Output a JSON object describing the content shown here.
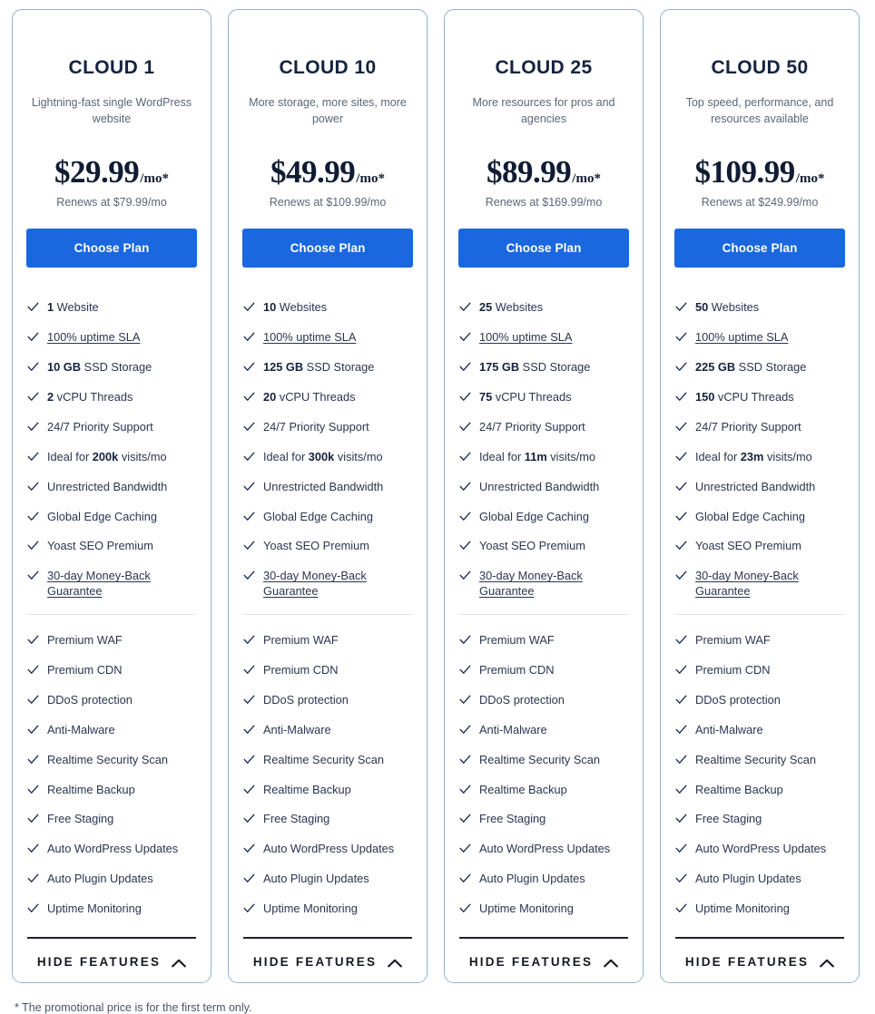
{
  "page": {
    "footnote": "* The promotional price is for the first term only.",
    "accent_color": "#1a67e0",
    "card_border_color": "#8fb4cf",
    "text_color": "#2b3550",
    "heading_color": "#15233f"
  },
  "labels": {
    "cta": "Choose Plan",
    "hide_features": "HIDE FEATURES",
    "check_icon": "check-icon",
    "chevron_up_icon": "chevron-up-icon"
  },
  "plans": [
    {
      "name": "CLOUD 1",
      "tagline": "Lightning-fast single WordPress website",
      "price": "$29.99",
      "price_suffix": "/mo*",
      "renews": "Renews at $79.99/mo",
      "cta": "Choose Plan",
      "features_primary": [
        {
          "bold": "1",
          "text": " Website",
          "underline": false
        },
        {
          "bold": "",
          "text": "100% uptime SLA",
          "underline": true
        },
        {
          "bold": "10 GB",
          "text": " SSD Storage",
          "underline": false
        },
        {
          "bold": "2",
          "text": " vCPU Threads",
          "underline": false
        },
        {
          "bold": "",
          "text": "24/7 Priority Support",
          "underline": false
        },
        {
          "bold": "",
          "text": "Ideal for ",
          "bold_mid": "200k",
          "text_after": " visits/mo",
          "underline": false
        },
        {
          "bold": "",
          "text": "Unrestricted Bandwidth",
          "underline": false
        },
        {
          "bold": "",
          "text": "Global Edge Caching",
          "underline": false
        },
        {
          "bold": "",
          "text": "Yoast SEO Premium",
          "underline": false
        },
        {
          "bold": "",
          "text": "30-day Money-Back Guarantee",
          "underline": true
        }
      ],
      "features_secondary": [
        "Premium WAF",
        "Premium CDN",
        "DDoS protection",
        "Anti-Malware",
        "Realtime Security Scan",
        "Realtime Backup",
        "Free Staging",
        "Auto WordPress Updates",
        "Auto Plugin Updates",
        "Uptime Monitoring"
      ],
      "hide_features": "HIDE FEATURES"
    },
    {
      "name": "CLOUD 10",
      "tagline": "More storage, more sites, more power",
      "price": "$49.99",
      "price_suffix": "/mo*",
      "renews": "Renews at $109.99/mo",
      "cta": "Choose Plan",
      "features_primary": [
        {
          "bold": "10",
          "text": " Websites",
          "underline": false
        },
        {
          "bold": "",
          "text": "100% uptime SLA",
          "underline": true
        },
        {
          "bold": "125 GB",
          "text": " SSD Storage",
          "underline": false
        },
        {
          "bold": "20",
          "text": " vCPU Threads",
          "underline": false
        },
        {
          "bold": "",
          "text": "24/7 Priority Support",
          "underline": false
        },
        {
          "bold": "",
          "text": "Ideal for ",
          "bold_mid": "300k",
          "text_after": " visits/mo",
          "underline": false
        },
        {
          "bold": "",
          "text": "Unrestricted Bandwidth",
          "underline": false
        },
        {
          "bold": "",
          "text": "Global Edge Caching",
          "underline": false
        },
        {
          "bold": "",
          "text": "Yoast SEO Premium",
          "underline": false
        },
        {
          "bold": "",
          "text": "30-day Money-Back Guarantee",
          "underline": true
        }
      ],
      "features_secondary": [
        "Premium WAF",
        "Premium CDN",
        "DDoS protection",
        "Anti-Malware",
        "Realtime Security Scan",
        "Realtime Backup",
        "Free Staging",
        "Auto WordPress Updates",
        "Auto Plugin Updates",
        "Uptime Monitoring"
      ],
      "hide_features": "HIDE FEATURES"
    },
    {
      "name": "CLOUD 25",
      "tagline": "More resources for pros and agencies",
      "price": "$89.99",
      "price_suffix": "/mo*",
      "renews": "Renews at $169.99/mo",
      "cta": "Choose Plan",
      "features_primary": [
        {
          "bold": "25",
          "text": " Websites",
          "underline": false
        },
        {
          "bold": "",
          "text": "100% uptime SLA",
          "underline": true
        },
        {
          "bold": "175 GB",
          "text": " SSD Storage",
          "underline": false
        },
        {
          "bold": "75",
          "text": " vCPU Threads",
          "underline": false
        },
        {
          "bold": "",
          "text": "24/7 Priority Support",
          "underline": false
        },
        {
          "bold": "",
          "text": "Ideal for ",
          "bold_mid": "11m",
          "text_after": " visits/mo",
          "underline": false
        },
        {
          "bold": "",
          "text": "Unrestricted Bandwidth",
          "underline": false
        },
        {
          "bold": "",
          "text": "Global Edge Caching",
          "underline": false
        },
        {
          "bold": "",
          "text": "Yoast SEO Premium",
          "underline": false
        },
        {
          "bold": "",
          "text": "30-day Money-Back Guarantee",
          "underline": true
        }
      ],
      "features_secondary": [
        "Premium WAF",
        "Premium CDN",
        "DDoS protection",
        "Anti-Malware",
        "Realtime Security Scan",
        "Realtime Backup",
        "Free Staging",
        "Auto WordPress Updates",
        "Auto Plugin Updates",
        "Uptime Monitoring"
      ],
      "hide_features": "HIDE FEATURES"
    },
    {
      "name": "CLOUD 50",
      "tagline": "Top speed, performance, and resources available",
      "price": "$109.99",
      "price_suffix": "/mo*",
      "renews": "Renews at $249.99/mo",
      "cta": "Choose Plan",
      "features_primary": [
        {
          "bold": "50",
          "text": " Websites",
          "underline": false
        },
        {
          "bold": "",
          "text": "100% uptime SLA",
          "underline": true
        },
        {
          "bold": "225 GB",
          "text": " SSD Storage",
          "underline": false
        },
        {
          "bold": "150",
          "text": " vCPU Threads",
          "underline": false
        },
        {
          "bold": "",
          "text": "24/7 Priority Support",
          "underline": false
        },
        {
          "bold": "",
          "text": "Ideal for ",
          "bold_mid": "23m",
          "text_after": " visits/mo",
          "underline": false
        },
        {
          "bold": "",
          "text": "Unrestricted Bandwidth",
          "underline": false
        },
        {
          "bold": "",
          "text": "Global Edge Caching",
          "underline": false
        },
        {
          "bold": "",
          "text": "Yoast SEO Premium",
          "underline": false
        },
        {
          "bold": "",
          "text": "30-day Money-Back Guarantee",
          "underline": true
        }
      ],
      "features_secondary": [
        "Premium WAF",
        "Premium CDN",
        "DDoS protection",
        "Anti-Malware",
        "Realtime Security Scan",
        "Realtime Backup",
        "Free Staging",
        "Auto WordPress Updates",
        "Auto Plugin Updates",
        "Uptime Monitoring"
      ],
      "hide_features": "HIDE FEATURES"
    }
  ]
}
